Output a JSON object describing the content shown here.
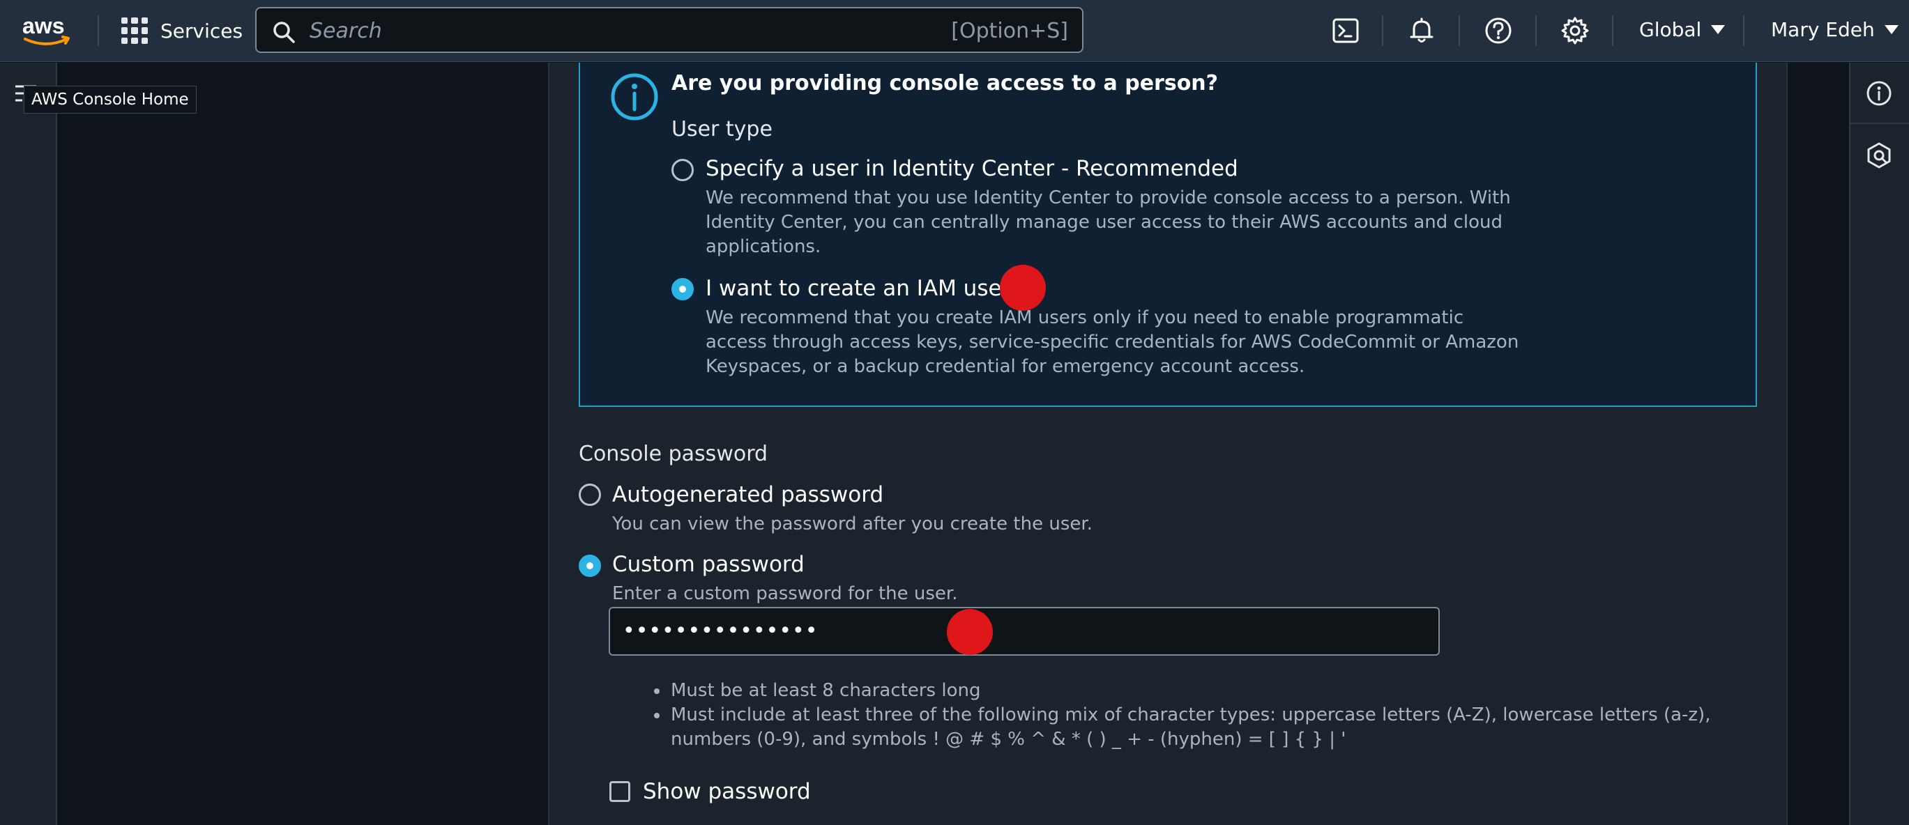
{
  "topnav": {
    "services_label": "Services",
    "search_placeholder": "Search",
    "search_shortcut": "[Option+S]",
    "region": "Global",
    "user": "Mary Edeh",
    "icons": [
      "cloudshell-icon",
      "bell-icon",
      "help-icon",
      "gear-icon"
    ]
  },
  "sidebar": {
    "tooltip": "AWS Console Home"
  },
  "info_box": {
    "title": "Are you providing console access to a person?",
    "user_type_label": "User type",
    "options": [
      {
        "label": "Specify a user in Identity Center - Recommended",
        "desc_lines": [
          "We recommend that you use Identity Center to provide console access to a person. With",
          "Identity Center, you can centrally manage user access to their AWS accounts and cloud",
          "applications."
        ],
        "checked": false
      },
      {
        "label": "I want to create an IAM user",
        "desc_lines": [
          "We recommend that you create IAM users only if you need to enable programmatic",
          "access through access keys, service-specific credentials for AWS CodeCommit or Amazon",
          "Keyspaces, or a backup credential for emergency account access."
        ],
        "checked": true
      }
    ]
  },
  "password": {
    "section_label": "Console password",
    "options": [
      {
        "label": "Autogenerated password",
        "desc": "You can view the password after you create the user.",
        "checked": false
      },
      {
        "label": "Custom password",
        "desc": "Enter a custom password for the user.",
        "checked": true
      }
    ],
    "input_value": "•••••••••••••••",
    "rules": [
      "Must be at least 8 characters long",
      "Must include at least three of the following mix of character types: uppercase letters (A-Z), lowercase letters (a-z), numbers (0-9), and symbols ! @ # $ % ^ & * ( ) _ + - (hyphen) = [ ] { } | '"
    ],
    "show_password_label": "Show password"
  },
  "colors": {
    "accent": "#2bb3e3",
    "info_border": "#1fa1c4",
    "nav_bg": "#232f3e",
    "annotation_dot": "#e0171a"
  }
}
